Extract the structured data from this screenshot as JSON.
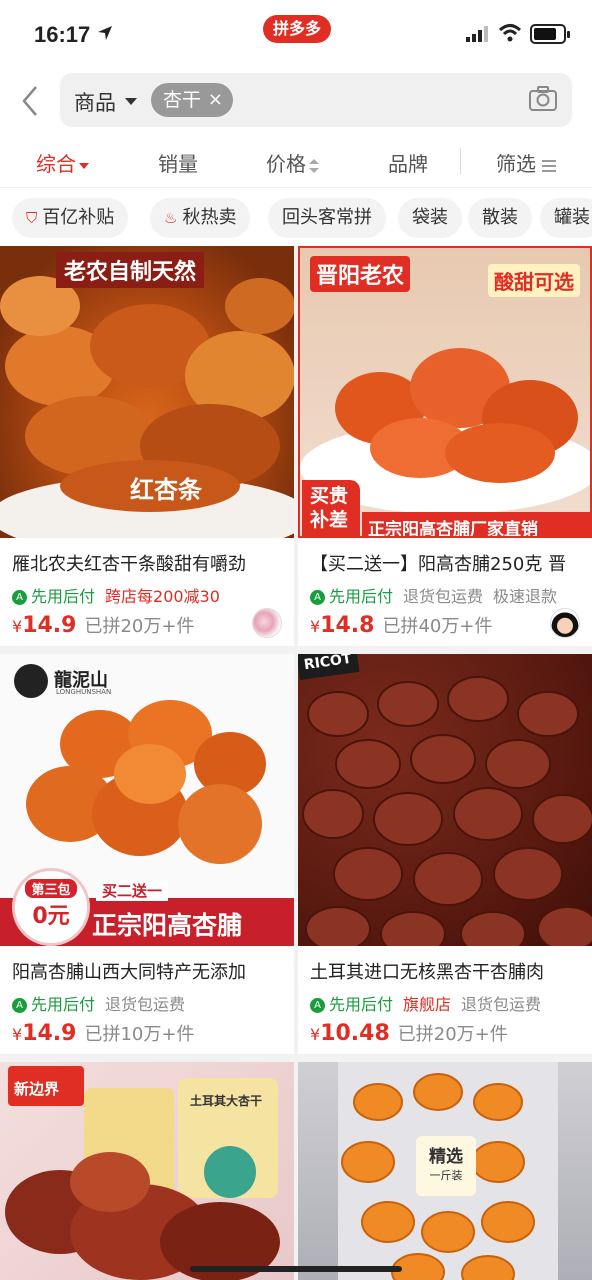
{
  "status": {
    "time": "16:17",
    "brand_badge": "拼多多"
  },
  "search": {
    "scope": "商品",
    "query_chip": "杏干",
    "chip_close": "×"
  },
  "sort_tabs": {
    "comprehensive": "综合",
    "sales": "销量",
    "price": "价格",
    "brand": "品牌",
    "filter": "筛选"
  },
  "tags": [
    "百亿补贴",
    "秋热卖",
    "回头客常拼",
    "袋装",
    "散装",
    "罐装"
  ],
  "colors": {
    "accent": "#e02e24",
    "green": "#1a9d3d",
    "gray": "#8a8a8a"
  },
  "products": [
    {
      "img_banner": "老农自制天然",
      "img_caption": "红杏条",
      "title": "雁北农夫红杏干条酸甜有嚼劲",
      "feature_after": "先用后付",
      "feature_2": "跨店每200减30",
      "currency": "¥",
      "price": "14.9",
      "sold": "已拼20万+件"
    },
    {
      "img_banner": "晋阳老农",
      "img_badge": "酸甜可选",
      "img_corner": "买贵补差",
      "img_bottom": "正宗阳高杏脯厂家直销",
      "title": "【买二送一】阳高杏脯250克 晋",
      "feature_after": "先用后付",
      "feature_2": "退货包运费",
      "feature_3": "极速退款",
      "currency": "¥",
      "price": "14.8",
      "sold": "已拼40万+件"
    },
    {
      "img_logo": "龍泥山",
      "img_logo_sub": "LONGHUNSHAN",
      "img_badge_top": "第三包",
      "img_badge_price": "0元",
      "img_promo": "买二送一",
      "img_bottom": "正宗阳高杏脯",
      "title": "阳高杏脯山西大同特产无添加",
      "feature_after": "先用后付",
      "feature_2": "退货包运费",
      "currency": "¥",
      "price": "14.9",
      "sold": "已拼10万+件"
    },
    {
      "img_label": "RICOT",
      "title": "土耳其进口无核黑杏干杏脯肉",
      "feature_after": "先用后付",
      "feature_2": "旗舰店",
      "feature_3": "退货包运费",
      "currency": "¥",
      "price": "10.48",
      "sold": "已拼20万+件"
    },
    {
      "img_logo": "新边界",
      "img_pack": "土耳其大杏干"
    },
    {
      "img_sticker_1": "精选",
      "img_sticker_2": "一斤装"
    }
  ]
}
